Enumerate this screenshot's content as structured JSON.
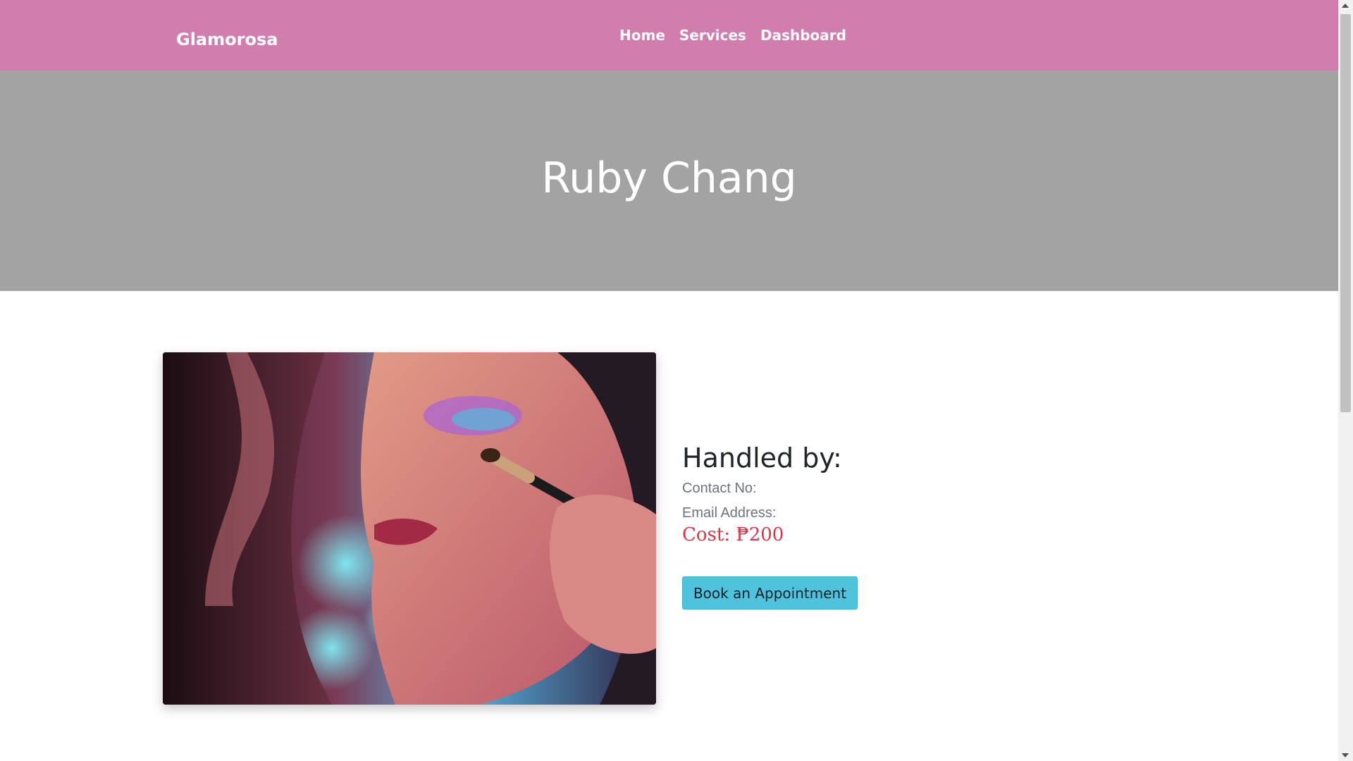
{
  "navbar": {
    "brand": "Glamorosa",
    "links": [
      {
        "label": "Home"
      },
      {
        "label": "Services"
      },
      {
        "label": "Dashboard"
      }
    ],
    "background_color": "#d17dae"
  },
  "hero": {
    "title": "Ruby Chang",
    "background_color": "#a3a3a3"
  },
  "service": {
    "image_alt": "makeup-application-photo",
    "handled_by_label": "Handled by:",
    "contact_label": "Contact No:",
    "email_label": "Email Address:",
    "cost_label": "Cost: ₱200",
    "book_button_label": "Book an Appointment",
    "button_color": "#4fc3dc",
    "cost_color": "#dc3545"
  }
}
